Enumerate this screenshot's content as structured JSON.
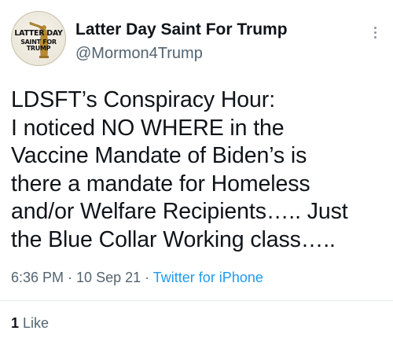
{
  "author": {
    "display_name": "Latter Day Saint For Trump",
    "handle": "@Mormon4Trump",
    "avatar_text_line1": "LATTER DAY",
    "avatar_text_line2": "SAINT FOR TRUMP",
    "avatar_icon": "angel-moroni-icon"
  },
  "tweet": {
    "text": "LDSFT’s Conspiracy Hour:\nI noticed NO WHERE in the\nVaccine Mandate of Biden’s is\nthere a mandate for Homeless\nand/or Welfare Recipients….. Just\nthe Blue Collar Working class…..",
    "time": "6:36 PM",
    "date": "10 Sep 21",
    "separator": " · ",
    "source": "Twitter for iPhone"
  },
  "engagement": {
    "like_count": "1",
    "like_label": "Like"
  },
  "colors": {
    "text_primary": "#0f1419",
    "text_secondary": "#536471",
    "link_blue": "#1d9bf0",
    "divider": "#e6e9ec"
  },
  "icons": {
    "more_menu": "more-vertical-icon"
  }
}
